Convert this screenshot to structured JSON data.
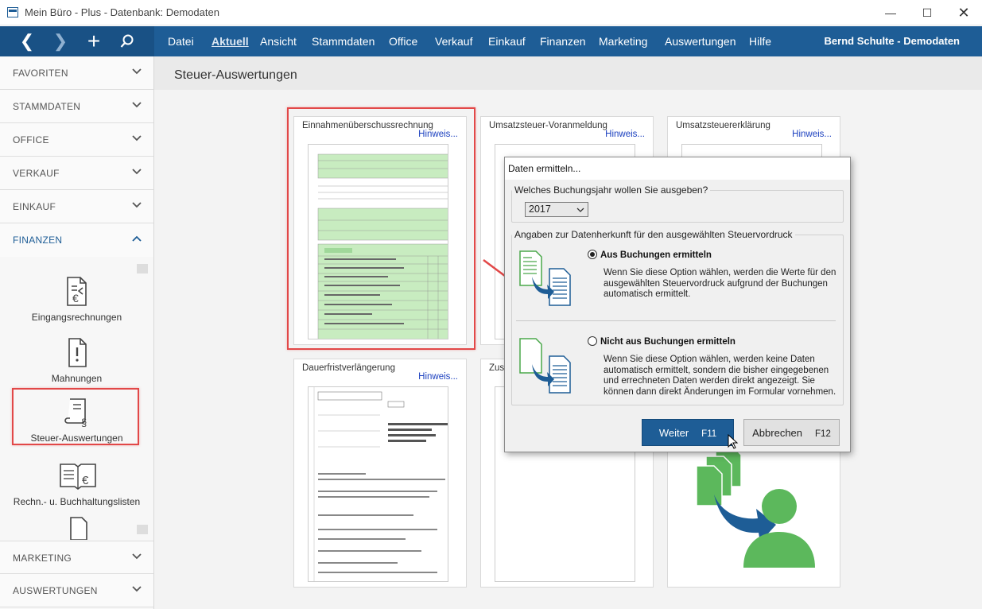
{
  "window": {
    "title": "Mein Büro - Plus - Datenbank: Demodaten"
  },
  "nav": {
    "menus": [
      "Datei",
      "Aktuell",
      "Ansicht",
      "Stammdaten",
      "Office",
      "Verkauf",
      "Einkauf",
      "Finanzen",
      "Marketing",
      "Auswertungen",
      "Hilfe"
    ],
    "active_menu": "Aktuell",
    "user": "Bernd Schulte - Demodaten"
  },
  "sidebar": {
    "sections": [
      "FAVORITEN",
      "STAMMDATEN",
      "OFFICE",
      "VERKAUF",
      "EINKAUF",
      "FINANZEN",
      "MARKETING",
      "AUSWERTUNGEN"
    ],
    "expanded": "FINANZEN",
    "sub_items": [
      "Eingangsrechnungen",
      "Mahnungen",
      "Steuer-Auswertungen",
      "Rechn.- u. Buchhaltungslisten"
    ],
    "selected": "Steuer-Auswertungen"
  },
  "content": {
    "title": "Steuer-Auswertungen",
    "cards": [
      {
        "title": "Einnahmenüberschussrechnung",
        "hint": "Hinweis..."
      },
      {
        "title": "Umsatzsteuer-Voranmeldung",
        "hint": "Hinweis..."
      },
      {
        "title": "Umsatzsteuererklärung",
        "hint": "Hinweis..."
      },
      {
        "title": "Dauerfristverlängerung",
        "hint": "Hinweis..."
      },
      {
        "title": "Zusa",
        "hint": ""
      }
    ]
  },
  "dialog": {
    "title": "Daten ermitteln...",
    "year_group": "Welches Buchungsjahr wollen Sie ausgeben?",
    "year_value": "2017",
    "source_group": "Angaben zur Datenherkunft für den ausgewählten Steuervordruck",
    "option1_label": "Aus Buchungen ermitteln",
    "option1_desc": [
      "Wenn Sie diese Option wählen, werden die Werte für den",
      "ausgewählten Steuervordruck aufgrund der Buchungen",
      "automatisch ermittelt."
    ],
    "option2_label": "Nicht aus Buchungen ermitteln",
    "option2_desc": [
      "Wenn Sie diese Option wählen, werden keine Daten",
      "automatisch ermittelt, sondern die bisher eingegebenen",
      "und errechneten Daten werden direkt angezeigt. Sie",
      "können dann direkt Änderungen im Formular vornehmen."
    ],
    "selected_option": 1,
    "next_label": "Weiter",
    "next_key": "F11",
    "cancel_label": "Abbrechen",
    "cancel_key": "F12"
  },
  "colors": {
    "nav": "#1e5d96",
    "highlight": "#e24848",
    "accent_green": "#4aa84a"
  }
}
